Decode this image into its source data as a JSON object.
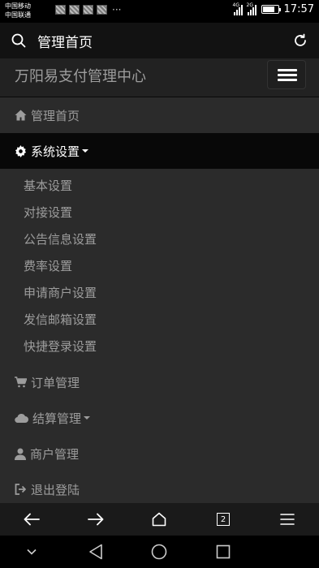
{
  "status": {
    "carrier1": "中国移动",
    "carrier2": "中国联通",
    "net1": "4G",
    "net2": "2G",
    "more": "···",
    "time": "17:57"
  },
  "browser": {
    "address_title": "管理首页",
    "tab_count": "2"
  },
  "page": {
    "brand": "万阳易支付管理中心",
    "menu": {
      "home": "管理首页",
      "settings": "系统设置",
      "settings_items": [
        "基本设置",
        "对接设置",
        "公告信息设置",
        "费率设置",
        "申请商户设置",
        "发信邮箱设置",
        "快捷登录设置"
      ],
      "orders": "订单管理",
      "settlement": "结算管理",
      "merchants": "商户管理",
      "logout": "退出登陆"
    }
  },
  "colors": {
    "navbar_bg": "#222222",
    "active_bg": "#080808",
    "link_color": "#9d9d9d"
  }
}
